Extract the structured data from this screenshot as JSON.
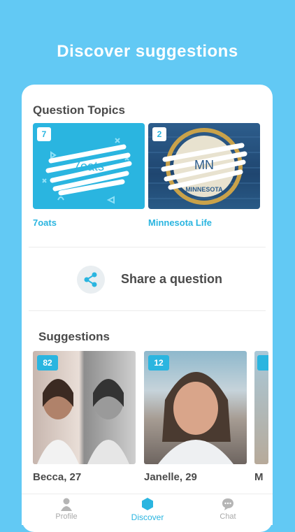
{
  "headline": "Discover suggestions",
  "topics": {
    "title": "Question Topics",
    "items": [
      {
        "count": "7",
        "tile_text": "7oats",
        "label": "7oats"
      },
      {
        "count": "2",
        "tile_text": "MN",
        "tile_subtext": "MINNESOTA",
        "label": "Minnesota Life"
      }
    ]
  },
  "share": {
    "label": "Share a question"
  },
  "suggestions": {
    "title": "Suggestions",
    "items": [
      {
        "count": "82",
        "name": "Becca, 27"
      },
      {
        "count": "12",
        "name": "Janelle, 29"
      },
      {
        "count": "",
        "name": "M"
      }
    ]
  },
  "tabs": [
    {
      "label": "Profile",
      "icon": "person-icon",
      "active": false
    },
    {
      "label": "Discover",
      "icon": "hexagon-icon",
      "active": true
    },
    {
      "label": "Chat",
      "icon": "chat-bubble-icon",
      "active": false
    }
  ],
  "colors": {
    "accent": "#2ab5e0",
    "background": "#62c9f4",
    "text": "#4a4a4a"
  }
}
